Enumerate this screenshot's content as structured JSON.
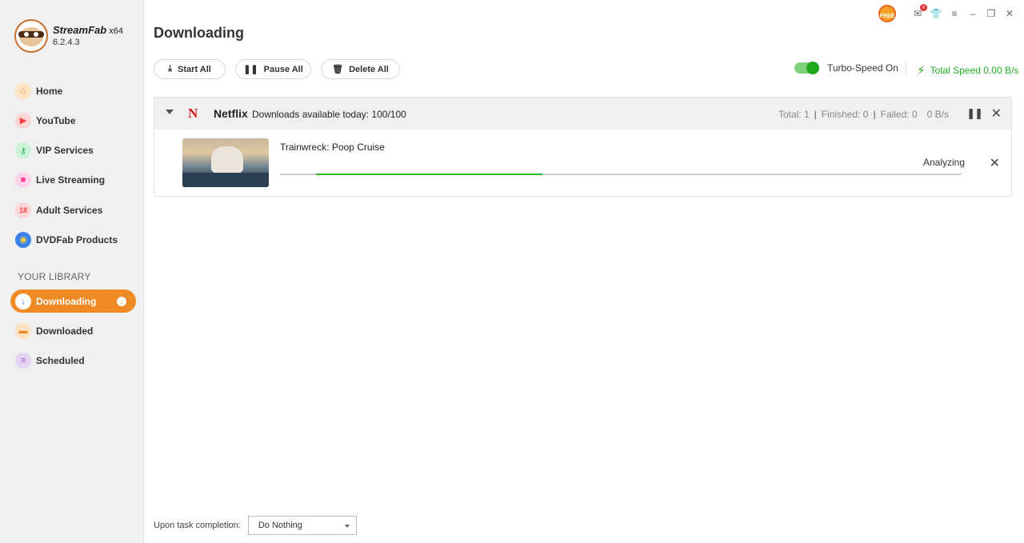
{
  "app": {
    "name": "StreamFab",
    "arch": "x64",
    "version": "6.2.4.3"
  },
  "sidebar": {
    "items": [
      {
        "label": "Home",
        "icon": "home-icon",
        "color": "#f5a34a"
      },
      {
        "label": "YouTube",
        "icon": "youtube-icon",
        "color": "#ff4d4d"
      },
      {
        "label": "VIP Services",
        "icon": "key-icon",
        "color": "#3cc65a"
      },
      {
        "label": "Live Streaming",
        "icon": "camera-icon",
        "color": "#ff4fa8"
      },
      {
        "label": "Adult Services",
        "icon": "adult-18-icon",
        "color": "#ff5d5d"
      },
      {
        "label": "DVDFab Products",
        "icon": "dvdfab-icon",
        "color": "#3a82e8"
      }
    ],
    "library_title": "YOUR LIBRARY",
    "library": [
      {
        "label": "Downloading",
        "icon": "download-icon",
        "active": true
      },
      {
        "label": "Downloaded",
        "icon": "folder-icon",
        "color": "#f5a34a"
      },
      {
        "label": "Scheduled",
        "icon": "schedule-list-icon",
        "color": "#a86fd6"
      }
    ]
  },
  "header": {
    "title": "Downloading",
    "start_all": "Start All",
    "pause_all": "Pause All",
    "delete_all": "Delete All",
    "turbo_label": "Turbo-Speed On",
    "turbo_on": true,
    "total_speed": "Total Speed 0.00 B/s",
    "notification_count": "6",
    "free_badge": "FREE"
  },
  "group": {
    "service": "Netflix",
    "availability": "Downloads available today: 100/100",
    "total": "Total: 1",
    "finished": "Finished: 0",
    "failed": "Failed: 0",
    "speed": "0 B/s"
  },
  "task": {
    "title": "Trainwreck: Poop Cruise",
    "status": "Analyzing",
    "progress_start": 0.053,
    "progress_end": 0.385
  },
  "footer": {
    "label": "Upon task completion:",
    "option": "Do Nothing"
  },
  "colors": {
    "accent": "#f08a24",
    "turbo_green": "#1fa91f",
    "speed_green": "#22b022",
    "netflix_red": "#d41a1a"
  }
}
